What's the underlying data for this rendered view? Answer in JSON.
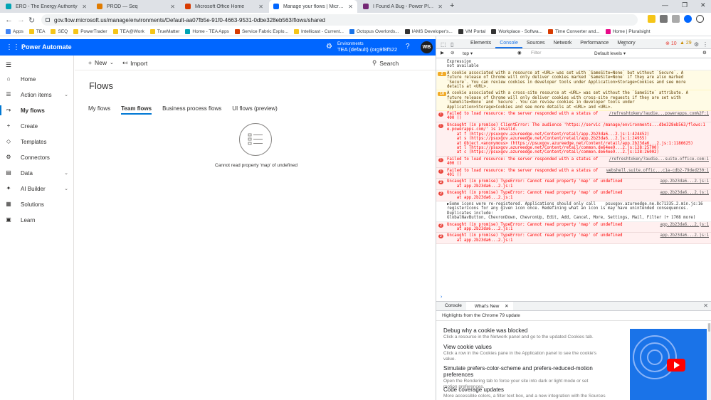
{
  "browser": {
    "tabs": [
      {
        "title": "ERO - The Energy Authority",
        "color": "#00a4b4"
      },
      {
        "title": "PROD — Seq",
        "color": "#e07b00"
      },
      {
        "title": "Microsoft Office Home",
        "color": "#d83b01"
      },
      {
        "title": "Manage your flows | Microsoft Flow",
        "color": "#0066ff"
      },
      {
        "title": "I Found A Bug - Power Platform Co",
        "color": "#742774"
      }
    ],
    "address": "gov.flow.microsoft.us/manage/environments/Default-aa07fb5e-91f0-4663-9531-0dbe328eb563/flows/shared",
    "bookmarks": [
      {
        "label": "Apps",
        "color": "#4285f4"
      },
      {
        "label": "TEA",
        "color": "#f5c518"
      },
      {
        "label": "SEQ",
        "color": "#f5c518"
      },
      {
        "label": "PowerTrader",
        "color": "#f5c518"
      },
      {
        "label": "TEA@Work",
        "color": "#f5c518"
      },
      {
        "label": "TrueMatter",
        "color": "#f5c518"
      },
      {
        "label": "Home - TEA Apps",
        "color": "#00a4b4"
      },
      {
        "label": "Service Fabric Explo...",
        "color": "#d83b01"
      },
      {
        "label": "Intellicast - Current...",
        "color": "#f5c518"
      },
      {
        "label": "Octopus Overlords...",
        "color": "#1a73e8"
      },
      {
        "label": "IAMS Developer's...",
        "color": "#333333"
      },
      {
        "label": "VM Portal",
        "color": "#333333"
      },
      {
        "label": "Workplace - Softwa...",
        "color": "#333333"
      },
      {
        "label": "Time Converter and...",
        "color": "#d83b01"
      },
      {
        "label": "Home | Pluralsight",
        "color": "#e80a89"
      }
    ]
  },
  "header": {
    "app_name": "Power Automate",
    "env_label": "Environments",
    "env_name": "TEA (default) (org9f8f522",
    "help": "?",
    "avatar_initials": "WB"
  },
  "nav": {
    "items": [
      {
        "label": "Home",
        "icon": "⌂"
      },
      {
        "label": "Action items",
        "icon": "☰"
      },
      {
        "label": "My flows",
        "icon": "⤳"
      },
      {
        "label": "Create",
        "icon": "+"
      },
      {
        "label": "Templates",
        "icon": "◇"
      },
      {
        "label": "Connectors",
        "icon": "⚙"
      },
      {
        "label": "Data",
        "icon": "▤"
      },
      {
        "label": "AI Builder",
        "icon": "✦"
      },
      {
        "label": "Solutions",
        "icon": "▦"
      },
      {
        "label": "Learn",
        "icon": "▣"
      }
    ]
  },
  "main": {
    "new_label": "New",
    "import_label": "Import",
    "search_label": "Search",
    "title": "Flows",
    "tabs": [
      "My flows",
      "Team flows",
      "Business process flows",
      "UI flows (preview)"
    ],
    "empty_message": "Cannot read property 'map' of undefined"
  },
  "devtools": {
    "tabs": [
      "Elements",
      "Console",
      "Sources",
      "Network",
      "Performance",
      "Memory"
    ],
    "errors": "10",
    "warnings": "29",
    "context": "top",
    "filter_placeholder": "Filter",
    "levels": "Default levels",
    "messages": [
      {
        "type": "plain",
        "badge": "",
        "text": "Expression\nnot available",
        "src": ""
      },
      {
        "type": "warn",
        "badge": "2",
        "text": "A cookie associated with a resource at <URL> was set with `SameSite=None` but without `Secure`. A\nfuture release of Chrome will only deliver cookies marked `SameSite=None` if they are also marked\n`Secure`. You can review cookies in developer tools under Application>Storage>Cookies and see more\ndetails at <URL>.",
        "src": ""
      },
      {
        "type": "warn",
        "badge": "10",
        "text": "A cookie associated with a cross-site resource at <URL> was set without the `SameSite` attribute. A\nfuture release of Chrome will only deliver cookies with cross-site requests if they are set with\n`SameSite=None` and `Secure`. You can review cookies in developer tools under\nApplication>Storage>Cookies and see more details at <URL> and <URL>.",
        "src": ""
      },
      {
        "type": "error",
        "badge": "!",
        "text": "Failed to load resource: the server responded with a status of\n400 ()",
        "src": "/refreshtoken/?audie...powerapps.com%2F:1"
      },
      {
        "type": "error",
        "badge": "!",
        "text": "Uncaught (in promise) ClientError: The audience 'https://servic /manage/environments...dbe328eb563/flows:1\ne.powerapps.com/' is invalid.\n    at f (https://psuxgov.azureedge.net/Content/retail/app.2b23da6...2.js:1:424452)\n    at s (https://psuxgov.azureedge.net/Content/retail/app.2b23da6...2.js:1:24955)\n    at Object.<anonymous> (https://psuxgov.azureedge.net/Content/retail/app.2b23da6...2.js:1:1186625)\n    at l (https://psuxgov.azureedge.net/Content/retail/common.de64ee9...2.js:128:25700)\n    at c (https://psuxgov.azureedge.net/Content/retail/common.de64ee9...2.js:128:26002)",
        "src": ""
      },
      {
        "type": "error",
        "badge": "!",
        "text": "Failed to load resource: the server responded with a status of\n400 ()",
        "src": "/refreshtoken/?audie...suite.office.com:1"
      },
      {
        "type": "error",
        "badge": "!",
        "text": "Failed to load resource: the server responded with a status of\n401 ()",
        "src": "webshell.suite.offic...c1a-cdb2-79ded230:1"
      },
      {
        "type": "error",
        "badge": "2",
        "text": "Uncaught (in promise) TypeError: Cannot read property 'map' of undefined\n    at app.2b23da6...2.js:1",
        "src": "app.2b23da6...2.js:1"
      },
      {
        "type": "error",
        "badge": "2",
        "text": "Uncaught (in promise) TypeError: Cannot read property 'map' of undefined\n    at app.2b23da6...2.js:1",
        "src": "app.2b23da6...2.js:1"
      },
      {
        "type": "info",
        "badge": "",
        "text": "▶Some icons were re-registered. Applications should only call    psuxgov.azureedge.ne.8c71335.2.min.js:16\nregisterIcons for any given icon once. Redefining what an icon is may have unintended consequences.\nDuplicates include:\nGlobalNavButton, ChevronDown, ChevronUp, Edit, Add, Cancel, More, Settings, Mail, Filter (+ 1708 more)",
        "src": ""
      },
      {
        "type": "error",
        "badge": "2",
        "text": "Uncaught (in promise) TypeError: Cannot read property 'map' of undefined\n    at app.2b23da6...2.js:1",
        "src": "app.2b23da6...2.js:1"
      },
      {
        "type": "error",
        "badge": "2",
        "text": "Uncaught (in promise) TypeError: Cannot read property 'map' of undefined\n    at app.2b23da6...2.js:1",
        "src": "app.2b23da6...2.js:1"
      }
    ],
    "drawer_tabs": [
      "Console",
      "What's New"
    ],
    "highlights": "Highlights from the Chrome 79 update",
    "whatsnew": [
      {
        "title": "Debug why a cookie was blocked",
        "desc": "Click a resource in the Network panel and go to the updated Cookies tab."
      },
      {
        "title": "View cookie values",
        "desc": "Click a row in the Cookies pane in the Application panel to see the cookie's\nvalue."
      },
      {
        "title": "Simulate prefers-color-scheme and prefers-reduced-motion preferences",
        "desc": "Open the Rendering tab to force your site into dark or light mode or set\nmotion preferences."
      },
      {
        "title": "Code coverage updates",
        "desc": "More accessible colors, a filter text box, and a new integration with the Sources"
      }
    ]
  }
}
